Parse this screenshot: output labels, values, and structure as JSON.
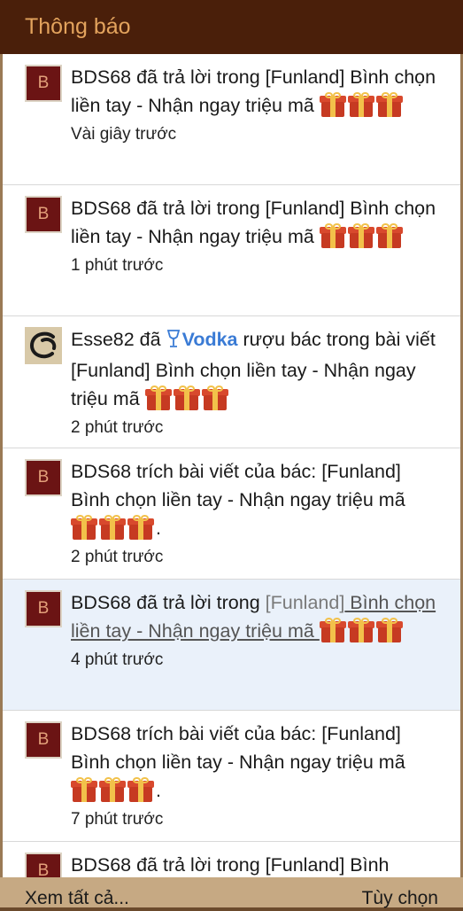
{
  "header": {
    "title": "Thông báo"
  },
  "items": [
    {
      "avatar": "B",
      "prefix": "BDS68 đã trả lời trong [Funland] Bình chọn liền tay - Nhận ngay triệu mã ",
      "gifts": 3,
      "time": "Vài giây trước"
    },
    {
      "avatar": "B",
      "prefix": "BDS68 đã trả lời trong [Funland] Bình chọn liền tay - Nhận ngay triệu mã ",
      "gifts": 3,
      "time": "1 phút trước"
    },
    {
      "avatar": "swirl-avatar",
      "user": "Esse82 đã ",
      "drink": "Vodka",
      "rest": " rượu bác trong bài viết [Funland] Bình chọn liền tay - Nhận ngay triệu mã ",
      "gifts": 3,
      "time": "2 phút trước"
    },
    {
      "avatar": "B",
      "prefix": "BDS68 trích bài viết của bác: [Funland] Bình chọn liền tay - Nhận ngay triệu mã ",
      "gifts": 3,
      "suffix": ".",
      "time": "2 phút trước"
    },
    {
      "avatar": "B",
      "user": "BDS68 đã trả lời trong ",
      "tag": "[Funland]",
      "title": " Bình chọn liền tay - Nhận ngay triệu mã ",
      "gifts": 3,
      "time": "4 phút trước"
    },
    {
      "avatar": "B",
      "prefix": "BDS68 trích bài viết của bác: [Funland] Bình chọn liền tay - Nhận ngay triệu mã ",
      "gifts": 3,
      "suffix": ".",
      "time": "7 phút trước"
    },
    {
      "avatar": "B",
      "prefix": "BDS68 đã trả lời trong [Funland] Bình"
    }
  ],
  "footer": {
    "view_all": "Xem tất cả...",
    "options": "Tùy chọn"
  },
  "colors": {
    "header_bg": "#4a1f0a",
    "header_text": "#e3a35d",
    "avatar_bg": "#6b1414",
    "link_blue": "#3a7bd5",
    "footer_bg": "#c6a983"
  }
}
